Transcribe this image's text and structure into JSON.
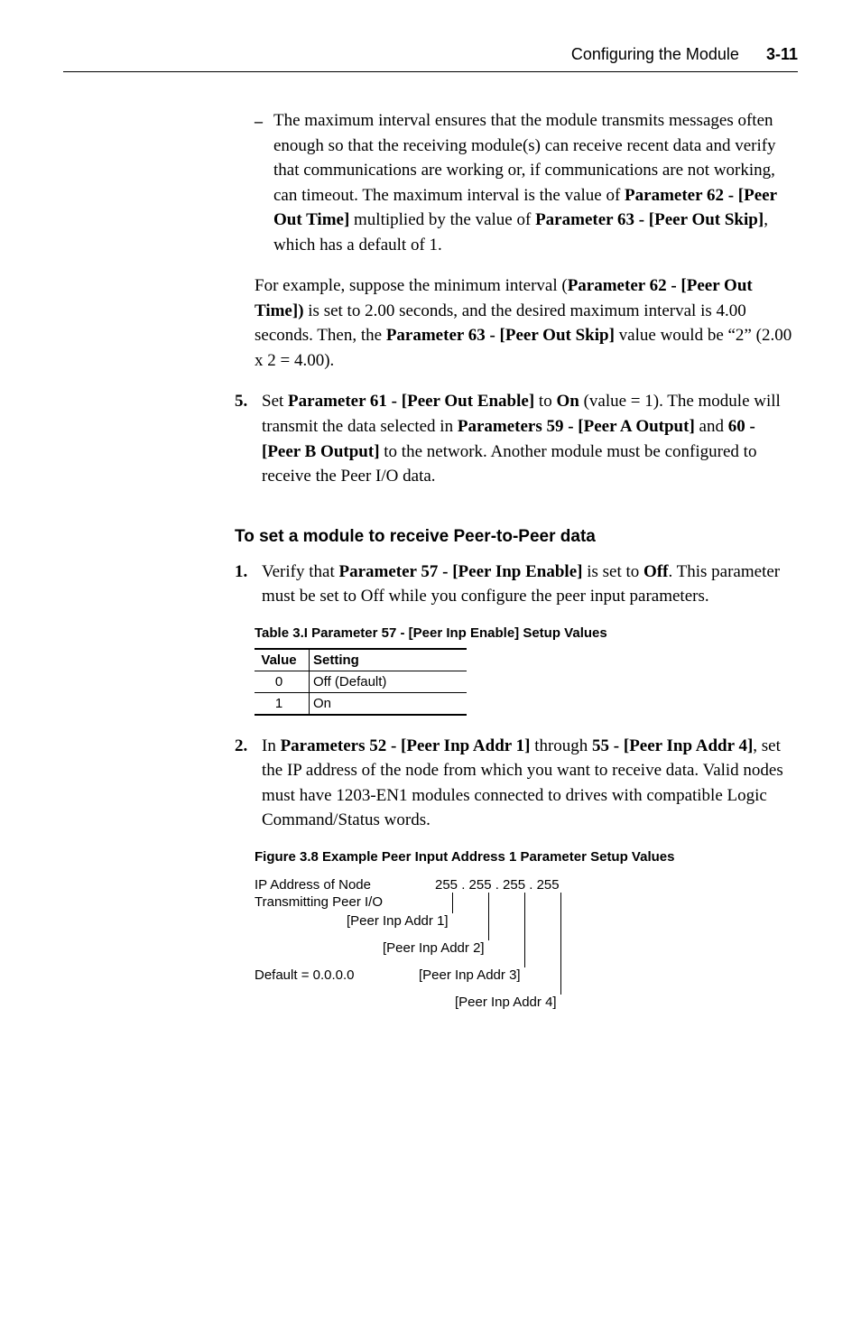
{
  "header": {
    "section_title": "Configuring the Module",
    "page_num": "3-11"
  },
  "bullet1": "The maximum interval ensures that the module transmits messages often enough so that the receiving module(s) can receive recent data and verify that communications are working or, if communications are not working, can timeout. The maximum interval is the value of <b>Parameter 62 - [Peer Out Time]</b> multiplied by the value of <b>Parameter 63 - [Peer Out Skip]</b>, which has a default of 1.",
  "para1": "For example, suppose the minimum interval (<b>Parameter 62 - [Peer Out Time])</b> is set to 2.00 seconds, and the desired maximum interval is 4.00 seconds. Then, the <b>Parameter 63 - [Peer Out Skip]</b> value would be “2” (2.00 x 2 = 4.00).",
  "step5": "Set <b>Parameter 61 - [Peer Out Enable]</b> to <b>On</b> (value = 1). The module will transmit the data selected in <b>Parameters 59 - [Peer A Output]</b> and <b>60 - [Peer B Output]</b> to the network. Another module must be configured to receive the Peer I/O data.",
  "subhead": "To set a module to receive Peer-to-Peer data",
  "step1": "Verify that <b>Parameter 57 - [Peer Inp Enable]</b> is set to <b>Off</b>. This parameter must be set to Off while you configure the peer input parameters.",
  "table3I": {
    "caption": "Table 3.I   Parameter 57 - [Peer Inp Enable] Setup Values",
    "headers": [
      "Value",
      "Setting"
    ],
    "rows": [
      {
        "value": "0",
        "setting": "Off (Default)"
      },
      {
        "value": "1",
        "setting": "On"
      }
    ]
  },
  "step2": "In <b>Parameters 52 - [Peer Inp Addr 1]</b> through <b>55 - [Peer Inp Addr 4]</b>, set the IP address of the node from which you want to receive data. Valid nodes must have 1203-EN1 modules connected to drives with compatible Logic Command/Status words.",
  "figure38_caption": "Figure 3.8   Example Peer Input Address 1 Parameter Setup Values",
  "diagram": {
    "ip_label": "IP Address of Node\nTransmitting Peer I/O",
    "octets": "255 . 255 . 255 . 255",
    "addr1": "[Peer Inp Addr 1]",
    "addr2": "[Peer Inp Addr 2]",
    "addr3": "[Peer Inp Addr 3]",
    "addr4": "[Peer Inp Addr 4]",
    "default": "Default = 0.0.0.0"
  }
}
